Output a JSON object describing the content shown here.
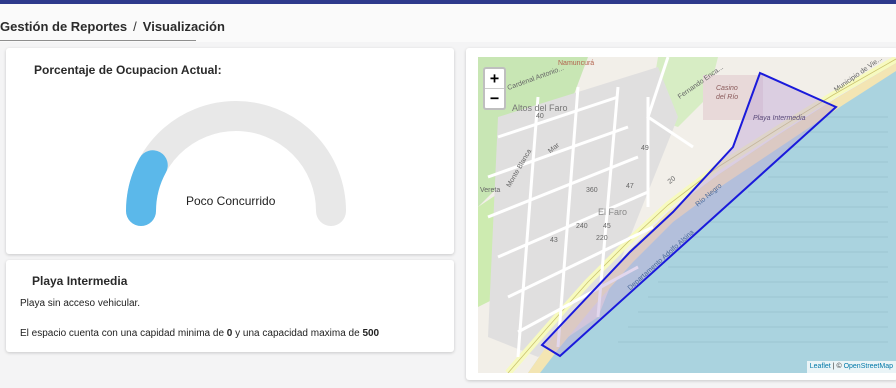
{
  "breadcrumb": {
    "section": "Gestión de Reportes",
    "separator": "/",
    "current": "Visualización"
  },
  "gauge": {
    "title": "Porcentaje de Ocupacion Actual:",
    "status_label": "Poco Concurrido",
    "level_fraction": 0.16,
    "fill_color": "#5bb8ea",
    "track_color": "#e8e8e8"
  },
  "beach": {
    "name": "Playa Intermedia",
    "access_text": "Playa sin acceso vehicular.",
    "capacity_prefix": "El espacio cuenta con una capidad minima de ",
    "min_capacity": "0",
    "capacity_middle": " y una capacidad maxima de ",
    "max_capacity": "500"
  },
  "map": {
    "zoom_in": "+",
    "zoom_out": "−",
    "attribution_leaflet": "Leaflet",
    "attribution_sep": " | © ",
    "attribution_osm": "OpenStreetMap",
    "polygon_color": "#1a1adb",
    "labels": {
      "namuncura": "Namuncurá",
      "altos_del_faro": "Altos del Faro",
      "casino": "Casino",
      "del_rio": "del Río",
      "municipio": "Municipio de Vie...",
      "playa_intermedia": "Playa Intermedia",
      "el_faro": "El Faro",
      "rio_negro": "Río Negro",
      "dept": "Departamento Adolfo Alsina",
      "route_20": "20",
      "fernando_enca": "Fernando Enca...",
      "mar": "Mar",
      "monte_blanca": "Monte Blanca",
      "cardenal": "Cardenal Antonio...",
      "vereta": "Vereta",
      "n40": "40",
      "n49": "49",
      "n47": "47",
      "n360": "360",
      "n240": "240",
      "n220": "220",
      "n43": "43",
      "n45": "45"
    }
  }
}
